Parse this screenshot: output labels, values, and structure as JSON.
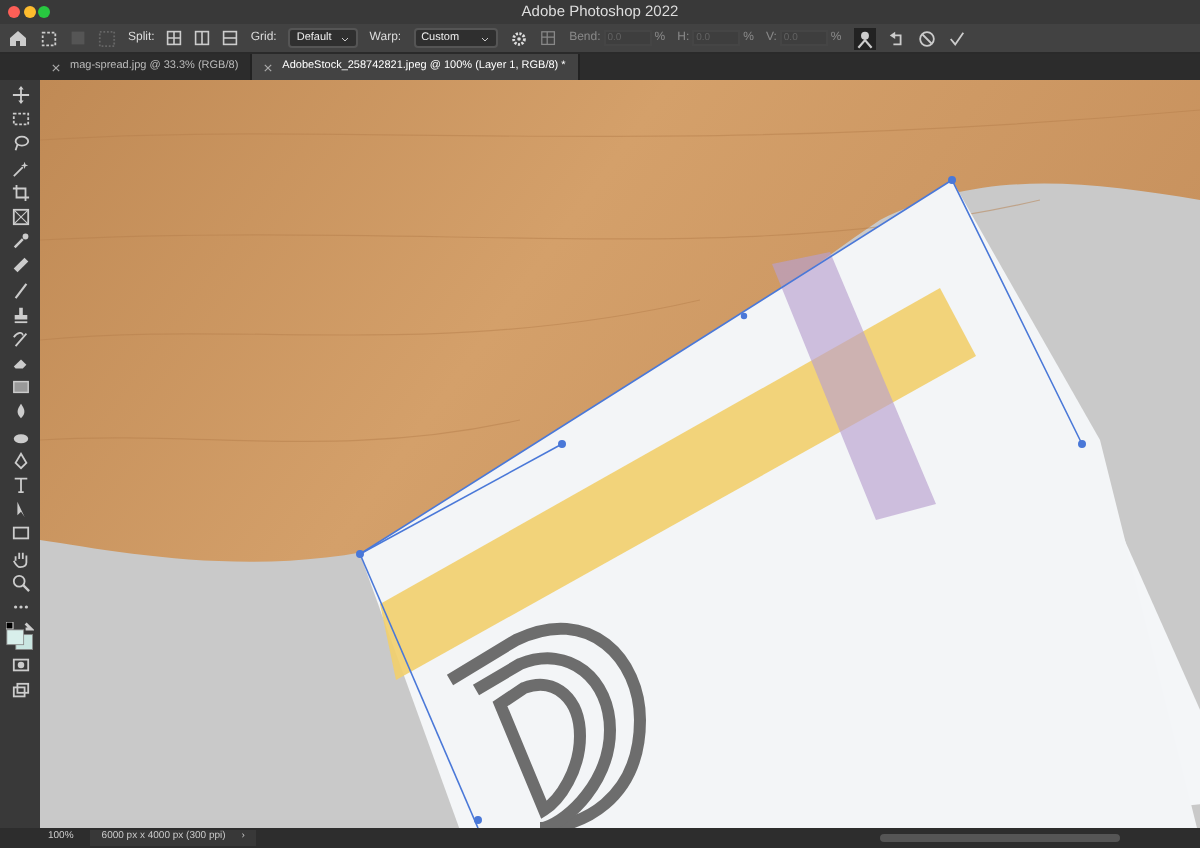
{
  "window": {
    "title": "Adobe Photoshop 2022"
  },
  "options_bar": {
    "split_label": "Split:",
    "grid_label": "Grid:",
    "grid_value": "Default",
    "warp_label": "Warp:",
    "warp_value": "Custom",
    "fields": [
      {
        "label": "Bend:",
        "value": "0.0",
        "unit": "%",
        "disabled": true
      },
      {
        "label": "H:",
        "value": "0.0",
        "unit": "%",
        "disabled": true
      },
      {
        "label": "V:",
        "value": "0.0",
        "unit": "%",
        "disabled": true
      }
    ]
  },
  "tabs": [
    {
      "label": "mag-spread.jpg @ 33.3% (RGB/8)",
      "selected": false
    },
    {
      "label": "AdobeStock_258742821.jpeg @ 100% (Layer 1, RGB/8) *",
      "selected": true
    }
  ],
  "status_bar": {
    "zoom": "100%",
    "document_info": "6000 px x 4000 px (300 ppi)",
    "arrow": "›"
  }
}
